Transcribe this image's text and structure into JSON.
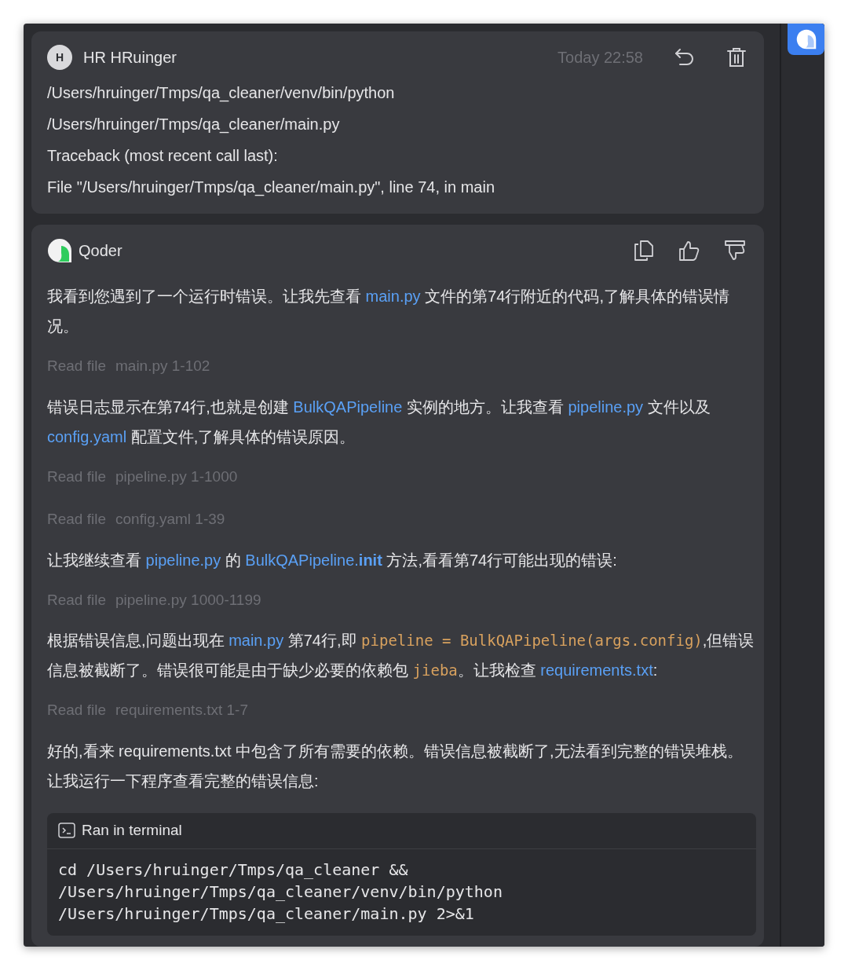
{
  "user_message": {
    "avatar_letter": "H",
    "author": "HR HRuinger",
    "time": "Today 22:58",
    "lines": [
      "/Users/hruinger/Tmps/qa_cleaner/venv/bin/python",
      "/Users/hruinger/Tmps/qa_cleaner/main.py",
      "Traceback (most recent call last):",
      "File \"/Users/hruinger/Tmps/qa_cleaner/main.py\", line 74, in main"
    ]
  },
  "assistant_message": {
    "name": "Qoder",
    "blocks": [
      {
        "kind": "paragraph",
        "segments": [
          {
            "kind": "text",
            "text": "我看到您遇到了一个运行时错误。让我先查看 "
          },
          {
            "kind": "link",
            "text": "main.py"
          },
          {
            "kind": "text",
            "text": " 文件的第74行附近的代码,了解具体的错误情况。"
          }
        ]
      },
      {
        "kind": "tool",
        "action": "Read file",
        "target": "main.py 1-102"
      },
      {
        "kind": "paragraph",
        "segments": [
          {
            "kind": "text",
            "text": "错误日志显示在第74行,也就是创建 "
          },
          {
            "kind": "link",
            "text": "BulkQAPipeline"
          },
          {
            "kind": "text",
            "text": " 实例的地方。让我查看 "
          },
          {
            "kind": "link",
            "text": "pipeline.py"
          },
          {
            "kind": "text",
            "text": " 文件以及 "
          },
          {
            "kind": "link",
            "text": "config.yaml"
          },
          {
            "kind": "text",
            "text": " 配置文件,了解具体的错误原因。"
          }
        ]
      },
      {
        "kind": "tool",
        "action": "Read file",
        "target": "pipeline.py 1-1000"
      },
      {
        "kind": "tool",
        "action": "Read file",
        "target": "config.yaml 1-39"
      },
      {
        "kind": "paragraph",
        "segments": [
          {
            "kind": "text",
            "text": "让我继续查看 "
          },
          {
            "kind": "link",
            "text": "pipeline.py"
          },
          {
            "kind": "text",
            "text": " 的 "
          },
          {
            "kind": "link",
            "text": "BulkQAPipeline.**init**"
          },
          {
            "kind": "text",
            "text": " 方法,看看第74行可能出现的错误:"
          }
        ]
      },
      {
        "kind": "tool",
        "action": "Read file",
        "target": "pipeline.py 1000-1199"
      },
      {
        "kind": "paragraph",
        "segments": [
          {
            "kind": "text",
            "text": "根据错误信息,问题出现在 "
          },
          {
            "kind": "link",
            "text": "main.py"
          },
          {
            "kind": "text",
            "text": " 第74行,即 "
          },
          {
            "kind": "code",
            "text": "pipeline = BulkQAPipeline(args.config)"
          },
          {
            "kind": "text",
            "text": ",但错误信息被截断了。错误很可能是由于缺少必要的依赖包 "
          },
          {
            "kind": "code",
            "text": "jieba"
          },
          {
            "kind": "text",
            "text": "。让我检查 "
          },
          {
            "kind": "link",
            "text": "requirements.txt"
          },
          {
            "kind": "text",
            "text": ":"
          }
        ]
      },
      {
        "kind": "tool",
        "action": "Read file",
        "target": "requirements.txt 1-7"
      },
      {
        "kind": "paragraph",
        "segments": [
          {
            "kind": "text",
            "text": "好的,看来 requirements.txt 中包含了所有需要的依赖。错误信息被截断了,无法看到完整的错误堆栈。让我运行一下程序查看完整的错误信息:"
          }
        ]
      },
      {
        "kind": "terminal",
        "title": "Ran in terminal",
        "command": [
          "cd /Users/hruinger/Tmps/qa_cleaner &&",
          "/Users/hruinger/Tmps/qa_cleaner/venv/bin/python",
          "/Users/hruinger/Tmps/qa_cleaner/main.py 2>&1"
        ]
      }
    ]
  }
}
